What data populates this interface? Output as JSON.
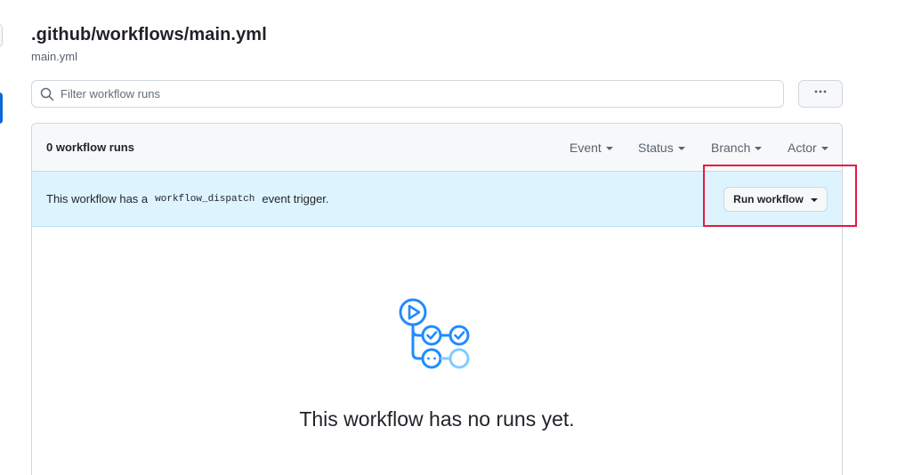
{
  "header": {
    "title": ".github/workflows/main.yml",
    "subtitle": "main.yml"
  },
  "filter": {
    "placeholder": "Filter workflow runs"
  },
  "runs": {
    "count_label": "0 workflow runs",
    "menus": {
      "event": "Event",
      "status": "Status",
      "branch": "Branch",
      "actor": "Actor"
    }
  },
  "dispatch_banner": {
    "text_before": "This workflow has a",
    "code": "workflow_dispatch",
    "text_after": "event trigger.",
    "run_button_label": "Run workflow"
  },
  "empty_state": {
    "title": "This workflow has no runs yet."
  },
  "icons": {
    "search": "search-icon",
    "more": "kebab-horizontal-icon",
    "empty": "workflow-graph-icon"
  },
  "colors": {
    "accent": "#0969da",
    "banner_bg": "#ddf4ff",
    "highlight": "#e8173f",
    "icon_blue": "#218bff",
    "icon_light_blue": "#80ccff"
  }
}
